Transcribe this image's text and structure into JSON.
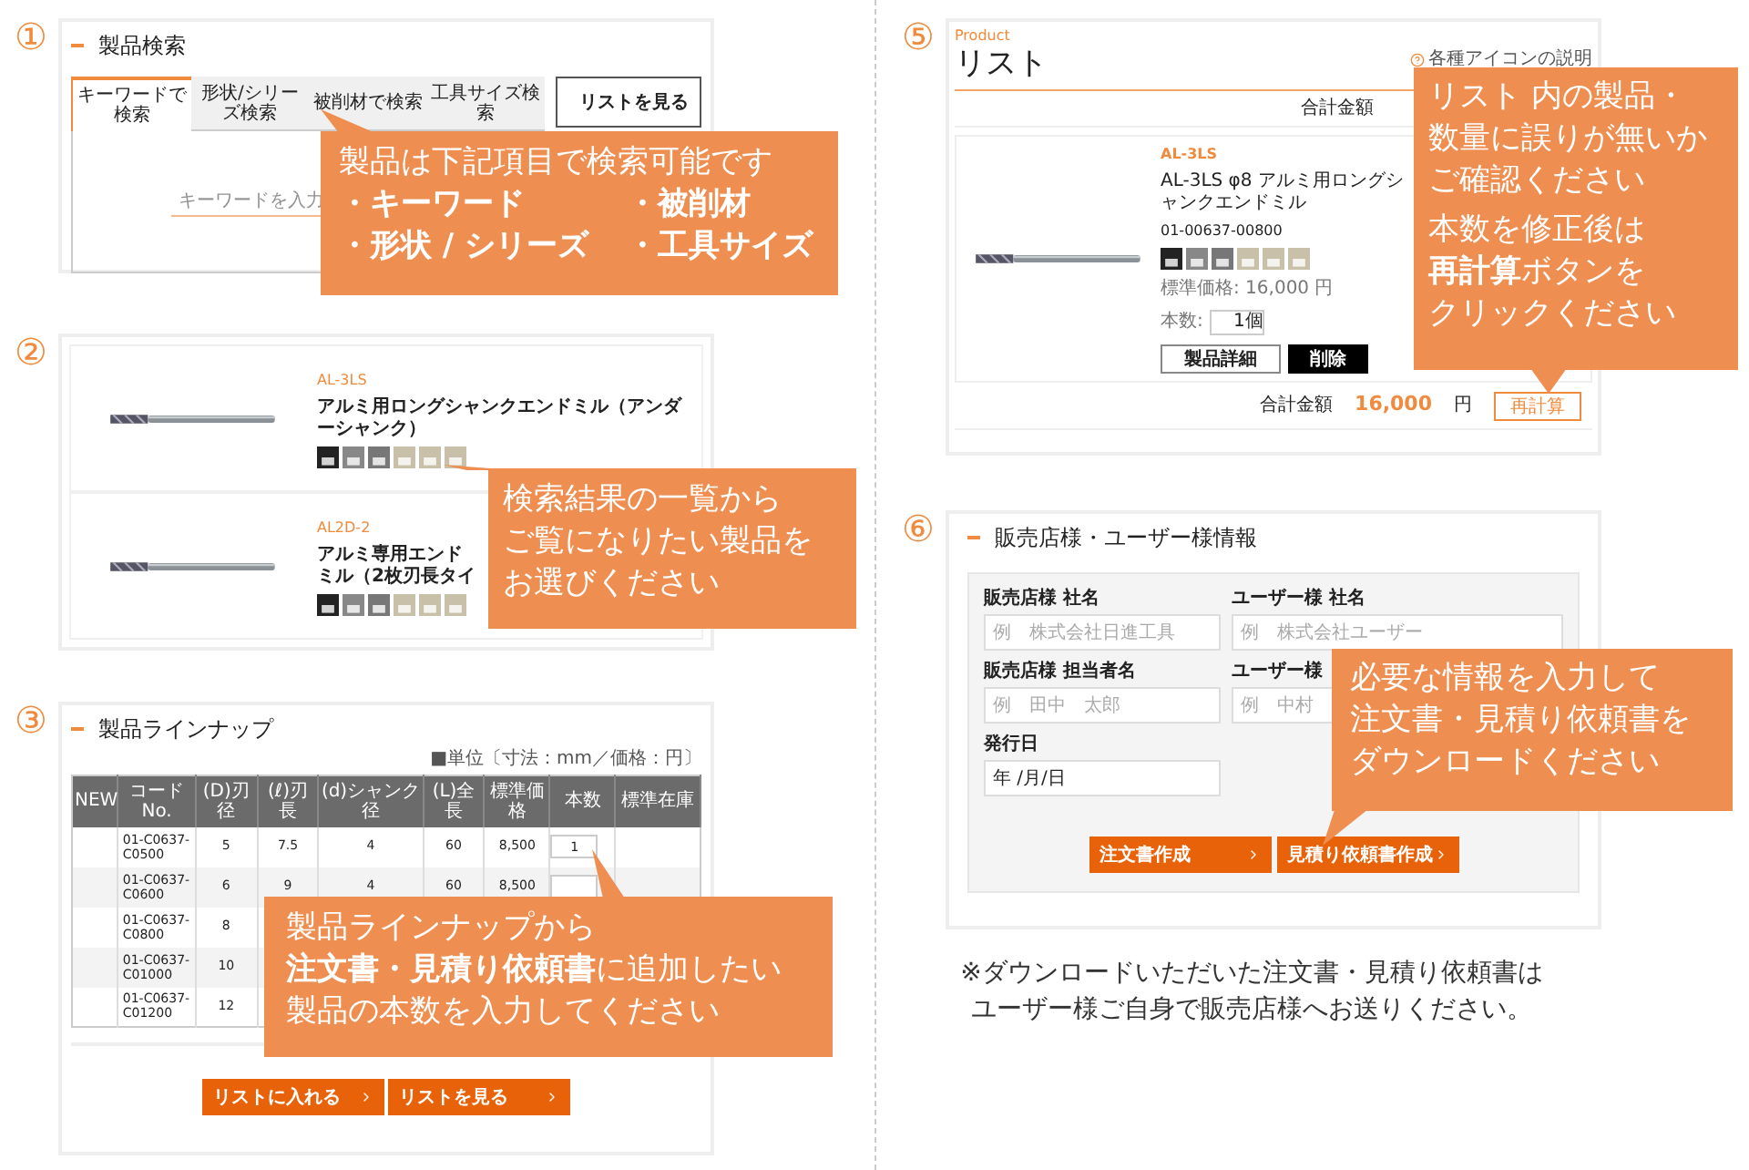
{
  "search_panel": {
    "step": "①",
    "title": "製品検索",
    "tabs": [
      {
        "label": "キーワードで検索",
        "selected": true
      },
      {
        "label": "形状/シリーズ検索",
        "selected": false
      },
      {
        "label": "被削材で検索",
        "selected": false
      },
      {
        "label": "工具サイズ検索",
        "selected": false
      }
    ],
    "list_button": "リストを見る",
    "keyword_field": {
      "placeholder": "キーワードを入力"
    },
    "callout": {
      "lines": [
        "製品は下記項目で検索可能です"
      ],
      "bullets": [
        "・キーワード",
        "・被削材",
        "・形状 / シリーズ",
        "・工具サイズ"
      ]
    }
  },
  "results_panel": {
    "step": "②",
    "products": [
      {
        "code": "AL-3LS",
        "name": "アルミ用ロングシャンクエンドミル（アンダーシャンク）"
      },
      {
        "code": "AL2D-2",
        "name": "アルミ専用エンドミル（2枚刃長タイ"
      }
    ],
    "callout": {
      "lines": [
        "検索結果の一覧から",
        "ご覧になりたい製品を",
        "お選びください"
      ]
    }
  },
  "lineup_panel": {
    "step": "③",
    "title": "製品ラインナップ",
    "unit_note": "■単位〔寸法：mm／価格：円〕",
    "columns": [
      "NEW",
      "コード No.",
      "(D)刃径",
      "(ℓ)刃長",
      "(d)シャンク径",
      "(L)全長",
      "標準価格",
      "本数",
      "標準在庫"
    ],
    "rows": [
      {
        "code": "01-C0637-C0500",
        "values": [
          "5",
          "7.5",
          "4",
          "60",
          "8,500"
        ],
        "quantity_field": true,
        "quantity": "1"
      },
      {
        "code": "01-C0637-C0600",
        "values": [
          "6",
          "9",
          "4",
          "60",
          "8,500"
        ],
        "quantity_field": true
      },
      {
        "code": "01-C0637-C0800",
        "values": [
          "8"
        ],
        "quantity_field": false
      },
      {
        "code": "01-C0637-C01000",
        "values": [
          "10"
        ],
        "quantity_field": false
      },
      {
        "code": "01-C0637-C01200",
        "values": [
          "12"
        ],
        "quantity_field": false
      }
    ],
    "buttons": [
      "リストに入れる",
      "リストを見る"
    ],
    "callout": {
      "lines": [
        "製品ラインナップから",
        "**注文書・見積り依頼書**に追加したい",
        "製品の本数を入力してください"
      ]
    }
  },
  "list_panel": {
    "step": "⑤",
    "eyebrow": "Product",
    "title": "リスト",
    "help_link": "各種アイコンの説明",
    "top_total_label": "合計金額",
    "product": {
      "code": "AL-3LS",
      "name": "AL-3LS φ8 アルミ用ロングシャンクエンドミル",
      "number": "01-00637-00800",
      "price": "標準価格: 16,000 円",
      "quantity_label": "本数:",
      "quantity": "1個",
      "buttons": [
        "製品詳細",
        "削除"
      ]
    },
    "total_label": "合計金額",
    "total": "16,000",
    "currency": "円",
    "recalc_button": "再計算",
    "callout": {
      "groups": [
        [
          "リスト 内の製品・",
          "数量に誤りが無いか",
          "ご確認ください"
        ],
        [
          "本数を修正後は",
          "**再計算**ボタンを",
          "クリックください"
        ]
      ]
    }
  },
  "info_panel": {
    "step": "⑥",
    "title": "販売店様・ユーザー様情報",
    "fields": [
      {
        "label": "販売店様 社名",
        "placeholder": "例　株式会社日進工具"
      },
      {
        "label": "ユーザー様 社名",
        "placeholder": "例　株式会社ユーザー"
      },
      {
        "label": "販売店様 担当者名",
        "placeholder": "例　田中　太郎"
      },
      {
        "label": "ユーザー様",
        "placeholder": "例　中村"
      },
      {
        "label": "発行日",
        "value": "年 /月/日"
      }
    ],
    "buttons": [
      "注文書作成",
      "見積り依頼書作成"
    ],
    "callout": {
      "lines": [
        "必要な情報を入力して",
        "注文書・見積り依頼書を",
        "ダウンロードください"
      ]
    }
  },
  "note": [
    "※ダウンロードいただいた注文書・見積り依頼書は",
    "ユーザー様ご自身で販売店様へお送りください。"
  ]
}
